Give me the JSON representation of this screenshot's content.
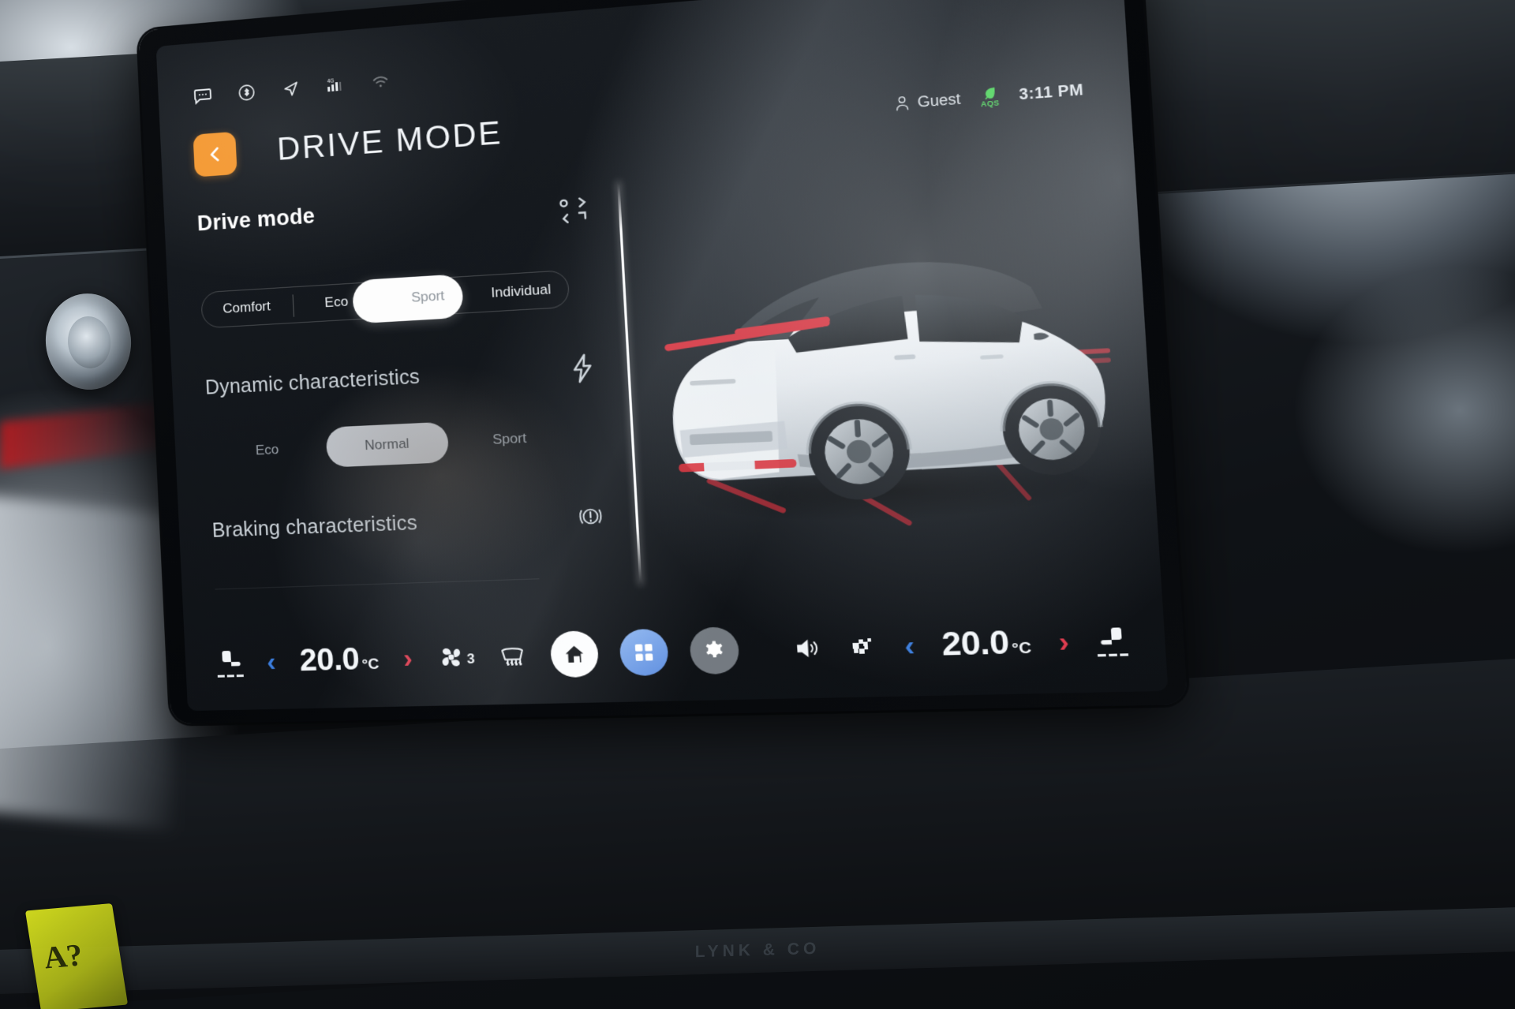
{
  "scene": {
    "dashboard_badge": "LYNK & CO"
  },
  "status_bar": {
    "icons": [
      {
        "name": "message-icon",
        "label": "Messages"
      },
      {
        "name": "bluetooth-icon",
        "label": "Bluetooth"
      },
      {
        "name": "navigation-arrow-icon",
        "label": "Navigation"
      },
      {
        "name": "signal-bars-4g-icon",
        "label": "4G Signal"
      },
      {
        "name": "wifi-icon",
        "label": "Wi-Fi"
      }
    ]
  },
  "header": {
    "back_label": "Back",
    "title": "DRIVE MODE",
    "user": "Guest",
    "aqs_label": "AQS",
    "time": "3:11 PM"
  },
  "drive_mode_panel": {
    "title": "Drive mode",
    "modes": [
      {
        "label": "Comfort",
        "selected": false
      },
      {
        "label": "Eco",
        "selected": false
      },
      {
        "label": "Sport",
        "selected": true
      },
      {
        "label": "Individual",
        "selected": false
      }
    ],
    "dynamic": {
      "title": "Dynamic characteristics",
      "icon": "lightning-bolt-icon",
      "options": [
        {
          "label": "Eco",
          "selected": false
        },
        {
          "label": "Normal",
          "selected": true
        },
        {
          "label": "Sport",
          "selected": false
        }
      ]
    },
    "braking": {
      "title": "Braking characteristics",
      "icon": "brake-warning-icon"
    }
  },
  "vehicle_preview": {
    "alt": "White Lynk & Co crossover, rear three-quarter view",
    "body_color": "#eef1f4",
    "accent_color": "#d9232e",
    "roof_color": "#2b2f34"
  },
  "dock": {
    "left": {
      "seat_heater_icon": "driver-seat-heater-icon",
      "dec_label": "‹",
      "temperature": "20.0",
      "unit": "°C",
      "inc_label": "›",
      "fan_icon": "fan-icon",
      "fan_speed": "3",
      "defrost_icon": "front-defrost-icon"
    },
    "center": [
      {
        "name": "home-button",
        "icon": "home-icon"
      },
      {
        "name": "apps-button",
        "icon": "apps-grid-icon"
      },
      {
        "name": "settings-button",
        "icon": "gear-icon"
      }
    ],
    "right": {
      "volume_icon": "volume-speaker-icon",
      "rear_defrost_icon": "rear-defrost-icon",
      "dec_label": "‹",
      "temperature": "20.0",
      "unit": "°C",
      "inc_label": "›",
      "seat_heater_icon": "passenger-seat-heater-icon"
    }
  },
  "colors": {
    "accent_orange": "#f5962b",
    "chevron_blue": "#3b7ddd",
    "chevron_red": "#e03b4e",
    "aqs_green": "#3fd34a",
    "apps_blue": "#6f9ce6"
  }
}
